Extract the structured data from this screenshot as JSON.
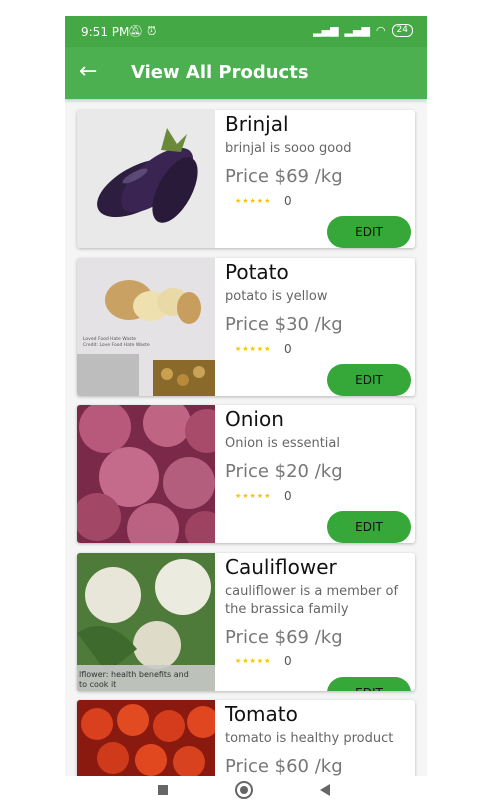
{
  "status": {
    "time": "9:51 PM",
    "battery": "24"
  },
  "appbar": {
    "title": "View All Products"
  },
  "edit_label": "EDIT",
  "stars": "★★★★★",
  "products": [
    {
      "name": "Brinjal",
      "desc": "brinjal is sooo good",
      "price": "Price $69 /kg",
      "rating": "0"
    },
    {
      "name": "Potato",
      "desc": "potato is yellow",
      "price": "Price $30 /kg",
      "rating": "0",
      "photo_text": [
        "Loved Food Hate Waste",
        "Credit: Love Food Hate Waste"
      ]
    },
    {
      "name": "Onion",
      "desc": "Onion is essential",
      "price": "Price $20 /kg",
      "rating": "0"
    },
    {
      "name": "Cauliflower",
      "desc": "cauliflower is a member of the brassica family",
      "price": "Price $69 /kg",
      "rating": "0",
      "photo_text": [
        "lflower: health benefits and",
        "to cook it"
      ]
    },
    {
      "name": "Tomato",
      "desc": "tomato is healthy product",
      "price": "Price $60 /kg"
    }
  ]
}
